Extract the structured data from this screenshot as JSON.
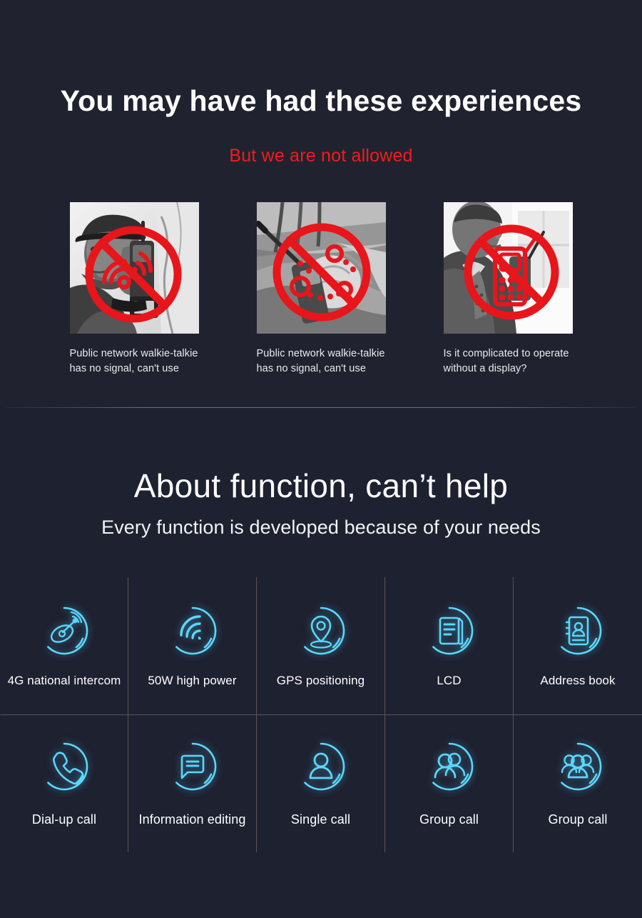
{
  "theme": {
    "background": "#20232f",
    "background_lower": "#1e2130",
    "accent_red": "#f41b1b",
    "accent_cyan": "#5ad7ff",
    "text_primary": "#ffffff",
    "grid_line": "#7e7868"
  },
  "problems_section": {
    "headline": "You may have had these experiences",
    "subheadline": "But we are not allowed",
    "cards": [
      {
        "photo_alt": "man-with-radio-photo",
        "sign": "no-signal-icon",
        "caption": "Public network walkie-talkie has no signal, can't use"
      },
      {
        "photo_alt": "hand-holding-walkie-talkie-photo",
        "sign": "no-network-icon",
        "caption": "Public network walkie-talkie has no signal, can't use"
      },
      {
        "photo_alt": "man-in-suit-with-radio-photo",
        "sign": "no-display-device-icon",
        "caption": "Is it complicated to operate without a display?"
      }
    ]
  },
  "functions_section": {
    "title": "About function, can’t help",
    "subtitle": "Every function is developed because of your needs",
    "features": [
      {
        "icon": "satellite-dish-icon",
        "label": "4G national intercom"
      },
      {
        "icon": "signal-waves-icon",
        "label": "50W high power"
      },
      {
        "icon": "location-pin-icon",
        "label": "GPS positioning"
      },
      {
        "icon": "document-screen-icon",
        "label": "LCD"
      },
      {
        "icon": "contact-card-icon",
        "label": "Address book"
      },
      {
        "icon": "phone-handset-icon",
        "label": "Dial-up call"
      },
      {
        "icon": "speech-bubble-icon",
        "label": "Information editing"
      },
      {
        "icon": "single-person-icon",
        "label": "Single call"
      },
      {
        "icon": "two-people-icon",
        "label": "Group call"
      },
      {
        "icon": "three-people-icon",
        "label": "Group call"
      }
    ]
  }
}
